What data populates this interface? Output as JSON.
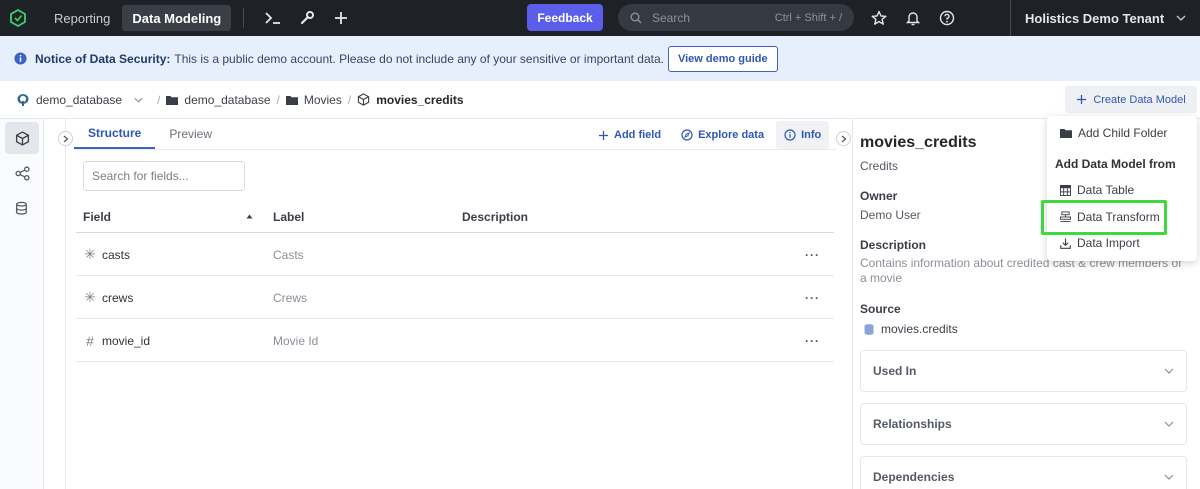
{
  "topbar": {
    "nav": [
      "Reporting",
      "Data Modeling"
    ],
    "feedback_label": "Feedback",
    "search_placeholder": "Search",
    "search_shortcut": "Ctrl + Shift + /",
    "tenant": "Holistics Demo Tenant"
  },
  "notice": {
    "title": "Notice of Data Security:",
    "message": "This is a public demo account. Please do not include any of your sensitive or important data.",
    "button": "View demo guide"
  },
  "breadcrumb": {
    "database": "demo_database",
    "folder": "demo_database",
    "subfolder": "Movies",
    "model": "movies_credits"
  },
  "create_button": "Create Data Model",
  "tabs": [
    "Structure",
    "Preview"
  ],
  "tab_actions": {
    "add_field": "Add field",
    "explore_data": "Explore data",
    "info": "Info"
  },
  "field_search_placeholder": "Search for fields...",
  "table": {
    "columns": [
      "Field",
      "Label",
      "Description"
    ],
    "rows": [
      {
        "type": "✳",
        "field": "casts",
        "label": "Casts",
        "description": ""
      },
      {
        "type": "✳",
        "field": "crews",
        "label": "Crews",
        "description": ""
      },
      {
        "type": "#",
        "field": "movie_id",
        "label": "Movie Id",
        "description": ""
      }
    ],
    "more": "···"
  },
  "info_panel": {
    "title": "movies_credits",
    "subtitle": "Credits",
    "owner_label": "Owner",
    "owner": "Demo User",
    "description_label": "Description",
    "description": "Contains information about credited cast & crew members of a movie",
    "source_label": "Source",
    "source": "movies.credits",
    "sections": [
      "Used In",
      "Relationships",
      "Dependencies"
    ]
  },
  "dropdown": {
    "add_child_folder": "Add Child Folder",
    "heading": "Add Data Model from",
    "items": [
      "Data Table",
      "Data Transform",
      "Data Import"
    ]
  },
  "colors": {
    "topbar": "#1e2126",
    "accent": "#5a5ee8",
    "link": "#2f57b8",
    "highlight": "#3ed93a",
    "notice_bg": "#e8effc"
  }
}
